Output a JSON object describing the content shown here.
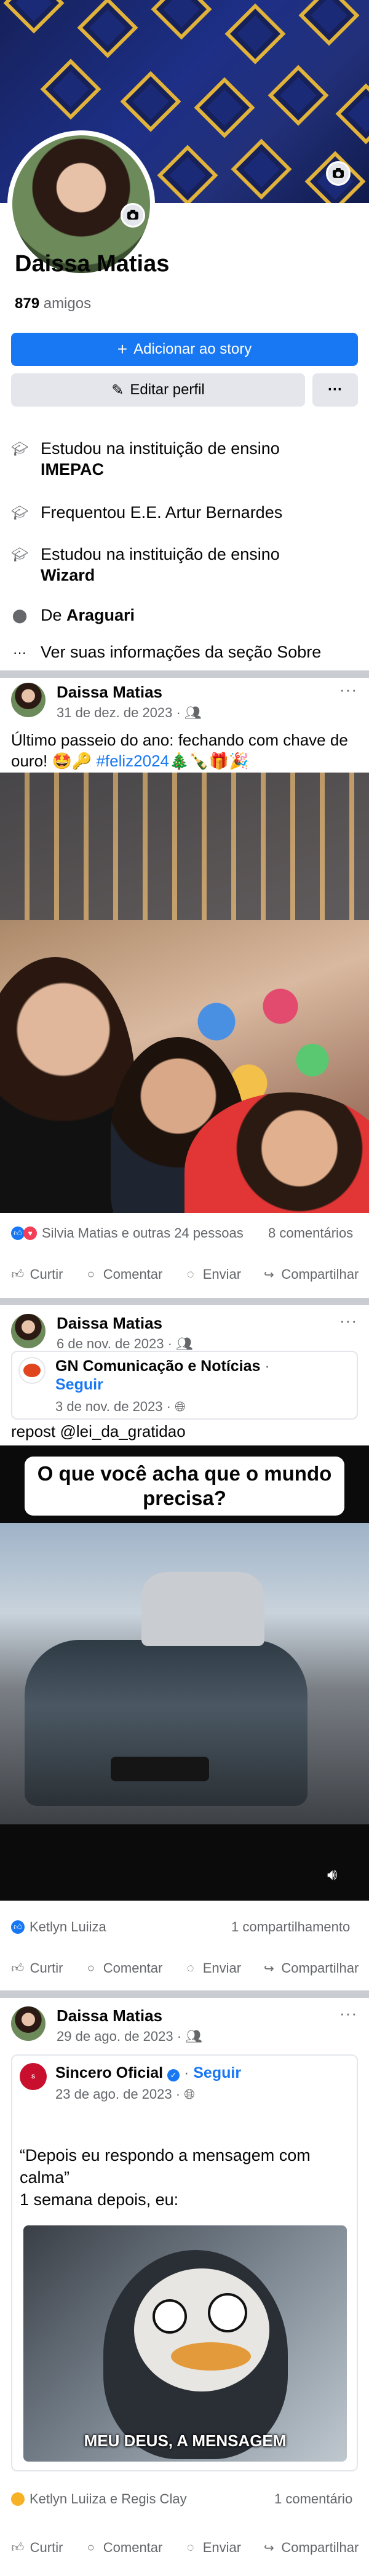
{
  "profile": {
    "name": "Daissa Matias",
    "friends_count": "879",
    "friends_label": "amigos",
    "add_story_label": "Adicionar ao story",
    "edit_profile_label": "Editar perfil",
    "more_label": "···"
  },
  "about": [
    {
      "icon": "graduation-cap-icon",
      "text": "Estudou na instituição de ensino",
      "bold": "IMEPAC"
    },
    {
      "icon": "graduation-cap-icon",
      "text": "Frequentou E.E. Artur Bernardes",
      "bold": ""
    },
    {
      "icon": "graduation-cap-icon",
      "text": "Estudou na instituição de ensino",
      "bold": "Wizard"
    },
    {
      "icon": "location-pin-icon",
      "text": "De",
      "bold": "Araguari"
    },
    {
      "icon": "ellipsis-icon",
      "text": "Ver suas informações da seção Sobre",
      "bold": ""
    }
  ],
  "posts": [
    {
      "author": "Daissa Matias",
      "date": "31 de dez. de 2023 ·",
      "text": "Último passeio do ano: fechando com chave de ouro! 🤩🔑",
      "hashtag": "#feliz2024",
      "emojis": "🎄🍾🎁🎉",
      "reactions_text": "Silvia Matias e outras 24 pessoas",
      "comments": "8 comentários"
    },
    {
      "author": "Daissa Matias",
      "date": "6 de nov. de 2023 ·",
      "shared_page": "GN Comunicação e Notícias",
      "follow": "Seguir",
      "shared_date": "3 de nov. de 2023 ·",
      "text": "repost @lei_da_gratidao",
      "video_caption": "O que você acha que o mundo precisa?",
      "reactions_text": "Ketlyn Luiiza",
      "shares": "1 compartilhamento"
    },
    {
      "author": "Daissa Matias",
      "date": "29 de ago. de 2023 ·",
      "shared_page": "Sincero Oficial",
      "follow": "Seguir",
      "shared_date": "23 de ago. de 2023 ·",
      "quote": "“Depois eu respondo a mensagem com calma”",
      "quote2": "1 semana depois, eu:",
      "meme_caption": "MEU DEUS, A MENSAGEM",
      "reactions_text": "Ketlyn Luiiza e Regis Clay",
      "comments": "1 comentário"
    }
  ],
  "actions": {
    "like": "Curtir",
    "comment": "Comentar",
    "send": "Enviar",
    "share": "Compartilhar"
  },
  "colors": {
    "accent": "#1877f2",
    "secondary_button": "#e4e6eb",
    "separator": "#c9ccd1"
  }
}
